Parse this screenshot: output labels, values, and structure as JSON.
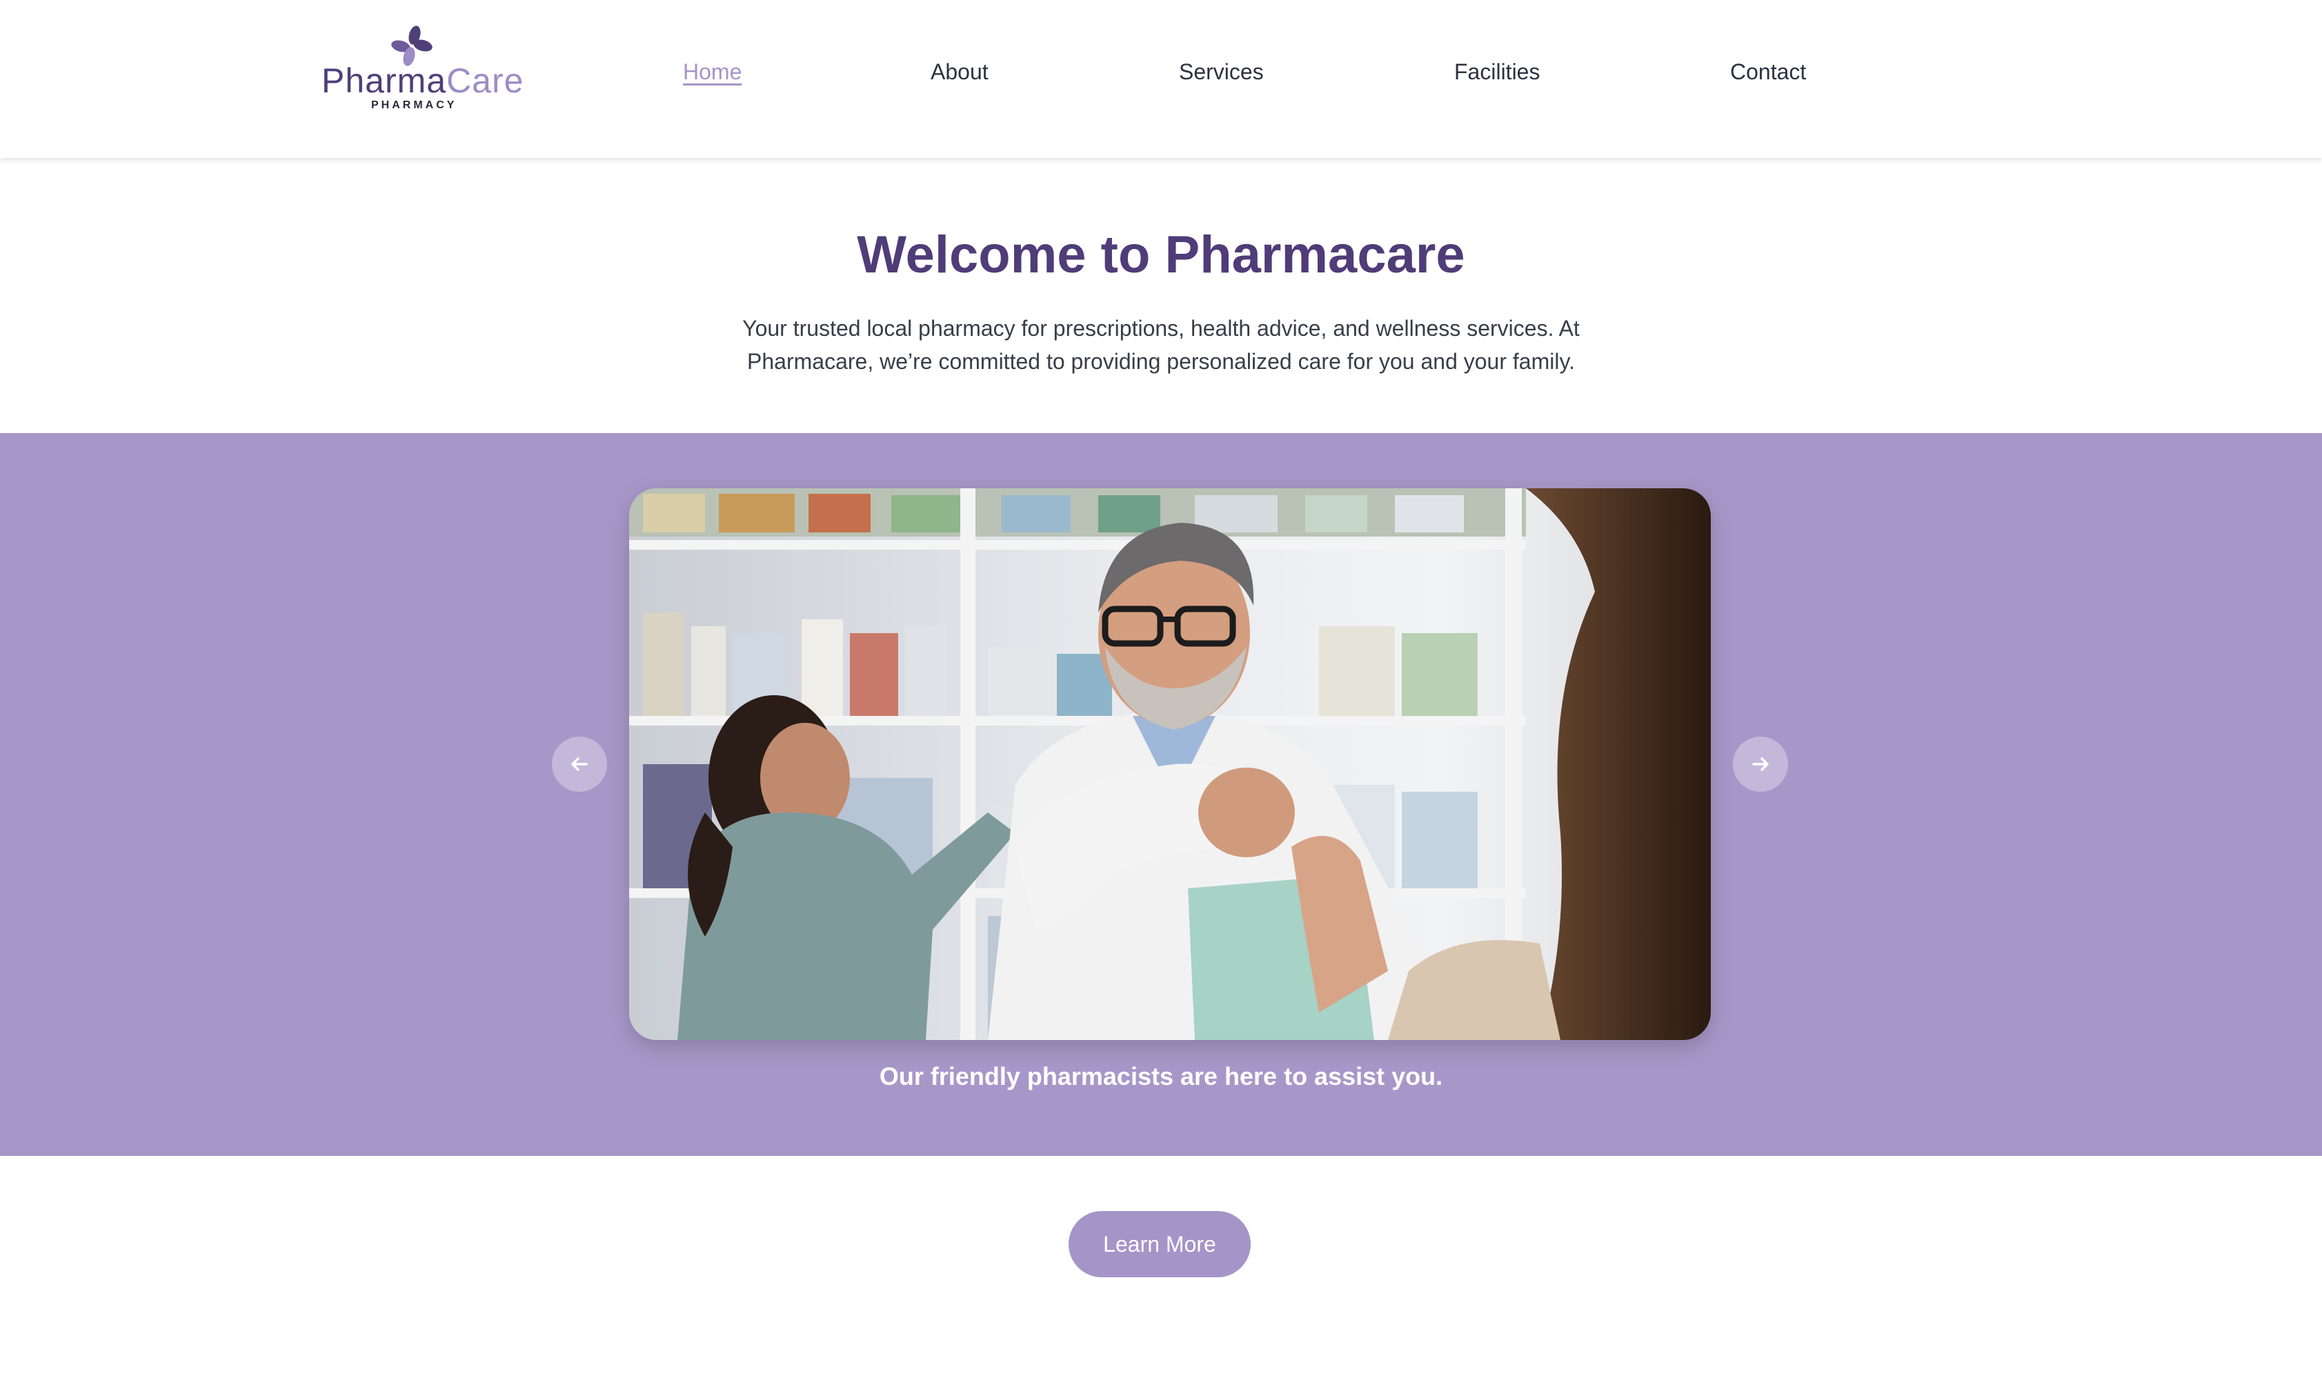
{
  "brand": {
    "name_part1": "Pharma",
    "name_part2": "Care",
    "tagline": "PHARMACY",
    "primary_color": "#4f3c78",
    "accent_color": "#a594c8",
    "band_color": "#a797c8"
  },
  "nav": {
    "items": [
      {
        "label": "Home",
        "active": true
      },
      {
        "label": "About",
        "active": false
      },
      {
        "label": "Services",
        "active": false
      },
      {
        "label": "Facilities",
        "active": false
      },
      {
        "label": "Contact",
        "active": false
      }
    ]
  },
  "hero": {
    "title": "Welcome to Pharmacare",
    "description": "Your trusted local pharmacy for prescriptions, health advice, and wellness services. At Pharmacare, we’re committed to providing personalized care for you and your family."
  },
  "carousel": {
    "caption": "Our friendly pharmacists are here to assist you.",
    "prev_icon": "arrow-left-icon",
    "next_icon": "arrow-right-icon"
  },
  "cta": {
    "label": "Learn More"
  }
}
